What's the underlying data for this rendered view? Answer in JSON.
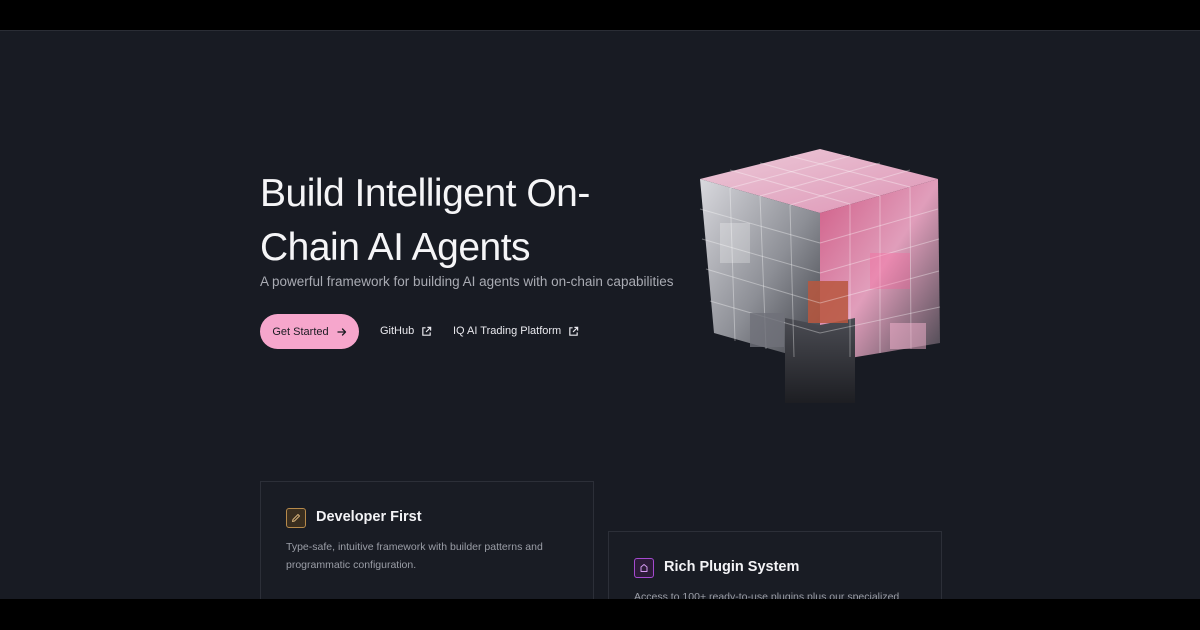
{
  "hero": {
    "title": "Build Intelligent On-Chain AI Agents",
    "subtitle": "A powerful framework for building AI agents with on-chain capabilities",
    "primary_button": "Get Started",
    "links": [
      "GitHub",
      "IQ AI Trading Platform"
    ]
  },
  "hero_image": {
    "name": "pink-glass-cube-illustration"
  },
  "features": [
    {
      "icon": "pencil-icon",
      "title": "Developer First",
      "description": "Type-safe, intuitive framework with builder patterns and programmatic configuration."
    },
    {
      "icon": "puzzle-icon",
      "title": "Rich Plugin System",
      "description": "Access to 100+ ready-to-use plugins plus our specialized"
    }
  ],
  "colors": {
    "background": "#181b23",
    "accent_pink": "#f6a6cc",
    "icon_gold": "#b78a4b",
    "icon_purple": "#a54ad0"
  }
}
